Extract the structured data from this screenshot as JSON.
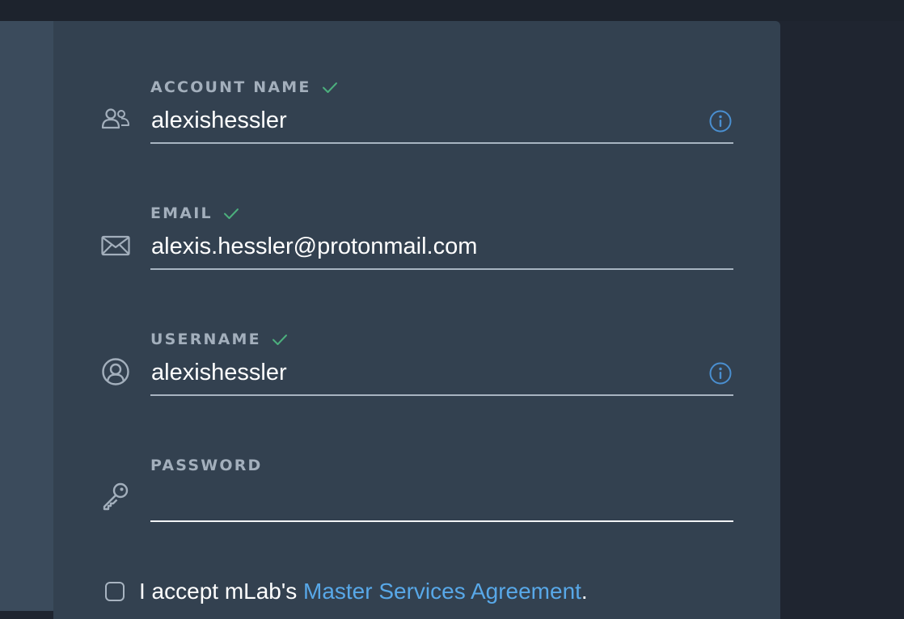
{
  "form": {
    "account_name": {
      "label": "ACCOUNT NAME",
      "value": "alexishessler",
      "validated": true,
      "icon": "account-icon"
    },
    "email": {
      "label": "EMAIL",
      "value": "alexis.hessler@protonmail.com",
      "validated": true,
      "icon": "envelope-icon"
    },
    "username": {
      "label": "USERNAME",
      "value": "alexishessler",
      "validated": true,
      "icon": "user-circle-icon"
    },
    "password": {
      "label": "PASSWORD",
      "value": "",
      "icon": "key-icon"
    },
    "agreement": {
      "prefix": "I accept mLab's ",
      "link_text": "Master Services Agreement",
      "suffix": ".",
      "checked": false
    }
  },
  "colors": {
    "background": "#1f2530",
    "card": "#334150",
    "side_panel": "#3b4b5c",
    "label": "#a3afbc",
    "check_green": "#4caf7d",
    "info_blue": "#4a8fd0",
    "link": "#58a8e8"
  }
}
